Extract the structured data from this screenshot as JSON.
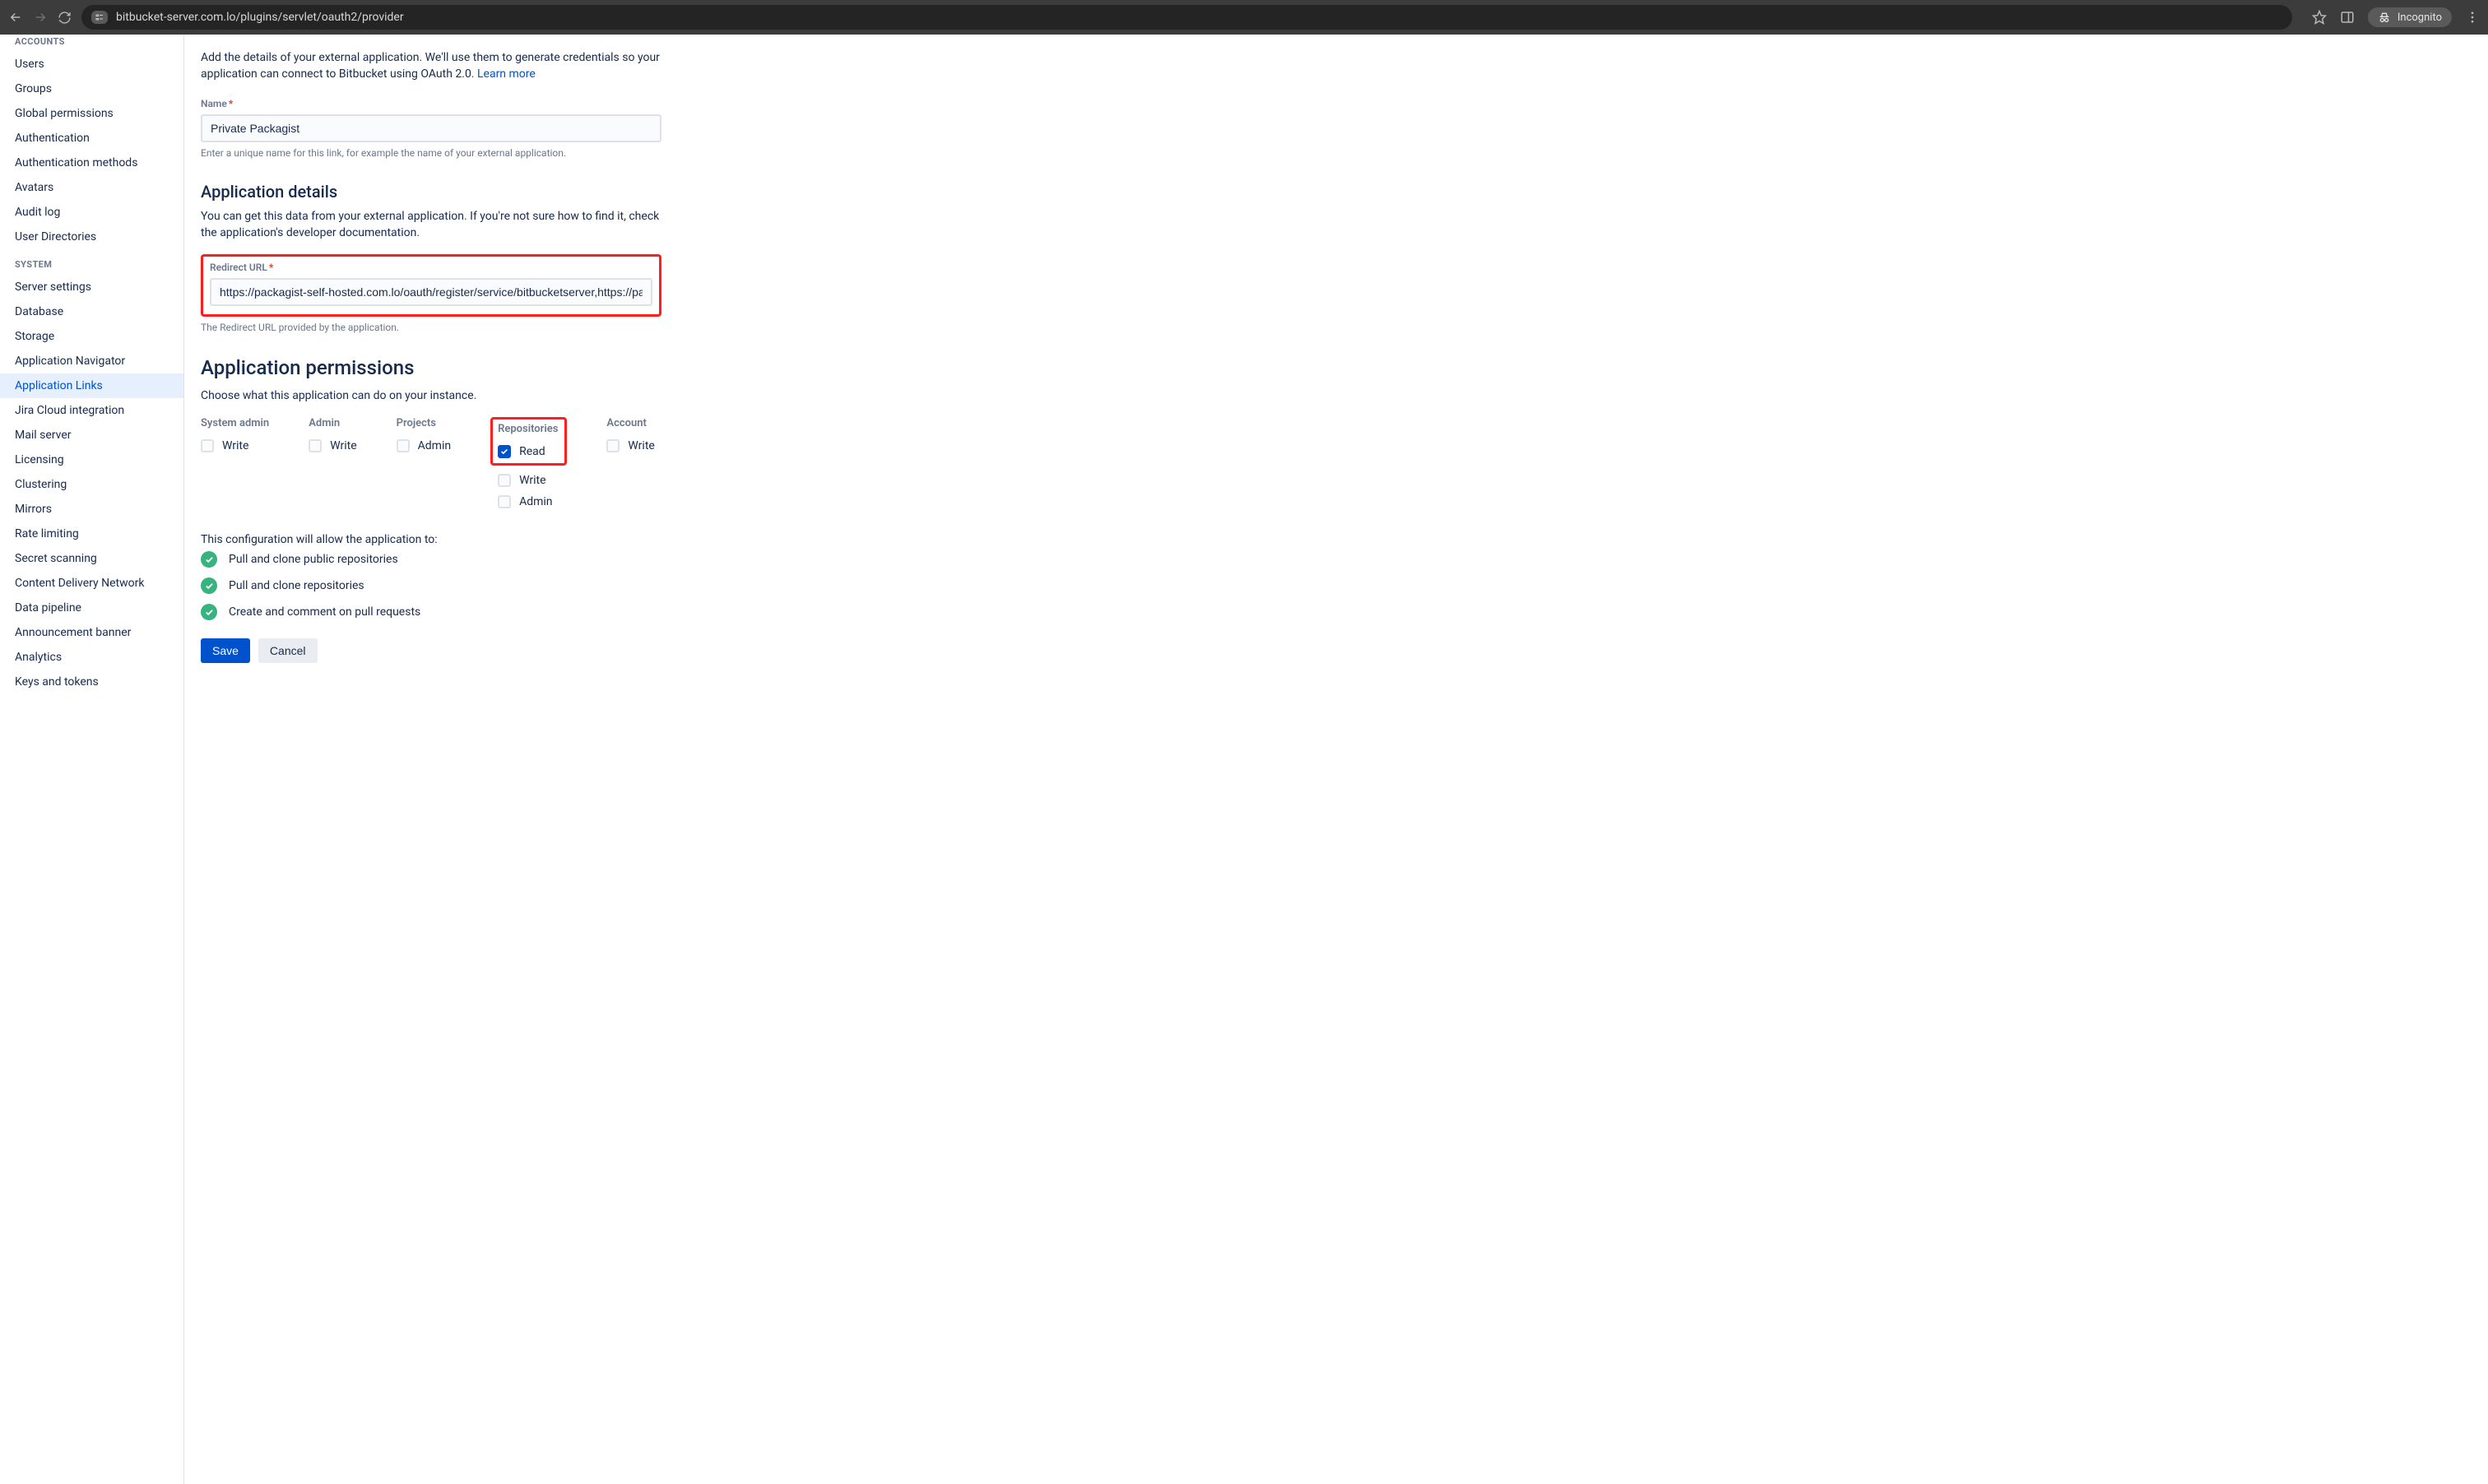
{
  "browser": {
    "url": "bitbucket-server.com.lo/plugins/servlet/oauth2/provider",
    "incognito_label": "Incognito"
  },
  "sidebar": {
    "group_accounts": "ACCOUNTS",
    "accounts_items": [
      "Users",
      "Groups",
      "Global permissions",
      "Authentication",
      "Authentication methods",
      "Avatars",
      "Audit log",
      "User Directories"
    ],
    "group_system": "SYSTEM",
    "system_items": [
      "Server settings",
      "Database",
      "Storage",
      "Application Navigator",
      "Application Links",
      "Jira Cloud integration",
      "Mail server",
      "Licensing",
      "Clustering",
      "Mirrors",
      "Rate limiting",
      "Secret scanning",
      "Content Delivery Network",
      "Data pipeline",
      "Announcement banner",
      "Analytics",
      "Keys and tokens"
    ],
    "active_system_index": 4
  },
  "form": {
    "intro_part1": "Add the details of your external application. We'll use them to generate credentials so your application can connect to Bitbucket using OAuth 2.0. ",
    "learn_more": "Learn more",
    "name_label": "Name",
    "name_value": "Private Packagist",
    "name_help": "Enter a unique name for this link, for example the name of your external application.",
    "app_details_heading": "Application details",
    "app_details_desc": "You can get this data from your external application. If you're not sure how to find it, check the application's developer documentation.",
    "redirect_label": "Redirect URL",
    "redirect_value": "https://packagist-self-hosted.com.lo/oauth/register/service/bitbucketserver,https://packagi",
    "redirect_help": "The Redirect URL provided by the application.",
    "perms_heading": "Application permissions",
    "perms_desc": "Choose what this application can do on your instance.",
    "cols": {
      "system_admin": "System admin",
      "admin": "Admin",
      "projects": "Projects",
      "repositories": "Repositories",
      "account": "Account"
    },
    "opts": {
      "write": "Write",
      "read": "Read",
      "admin": "Admin"
    },
    "allow_intro": "This configuration will allow the application to:",
    "allows": [
      "Pull and clone public repositories",
      "Pull and clone repositories",
      "Create and comment on pull requests"
    ],
    "save": "Save",
    "cancel": "Cancel"
  }
}
